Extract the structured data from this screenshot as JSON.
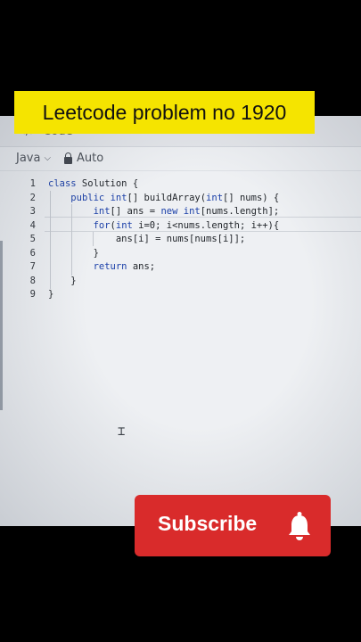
{
  "banner": {
    "title": "Leetcode problem no 1920"
  },
  "editor_header": {
    "tab_label": "</> Code"
  },
  "toolbar": {
    "language": "Java",
    "mode": "Auto"
  },
  "code_lines": [
    {
      "num": "1",
      "text": "class Solution {"
    },
    {
      "num": "2",
      "text": "    public int[] buildArray(int[] nums) {"
    },
    {
      "num": "3",
      "text": "        int[] ans = new int[nums.length];"
    },
    {
      "num": "4",
      "text": "        for(int i=0; i<nums.length; i++){"
    },
    {
      "num": "5",
      "text": "            ans[i] = nums[nums[i]];"
    },
    {
      "num": "6",
      "text": "        }"
    },
    {
      "num": "7",
      "text": "        return ans;"
    },
    {
      "num": "8",
      "text": "    }"
    },
    {
      "num": "9",
      "text": "}"
    }
  ],
  "subscribe": {
    "label": "Subscribe",
    "icon": "bell-icon"
  },
  "colors": {
    "banner_bg": "#f5e400",
    "subscribe_bg": "#d92b2b",
    "keyword": "#1a3fa8"
  }
}
